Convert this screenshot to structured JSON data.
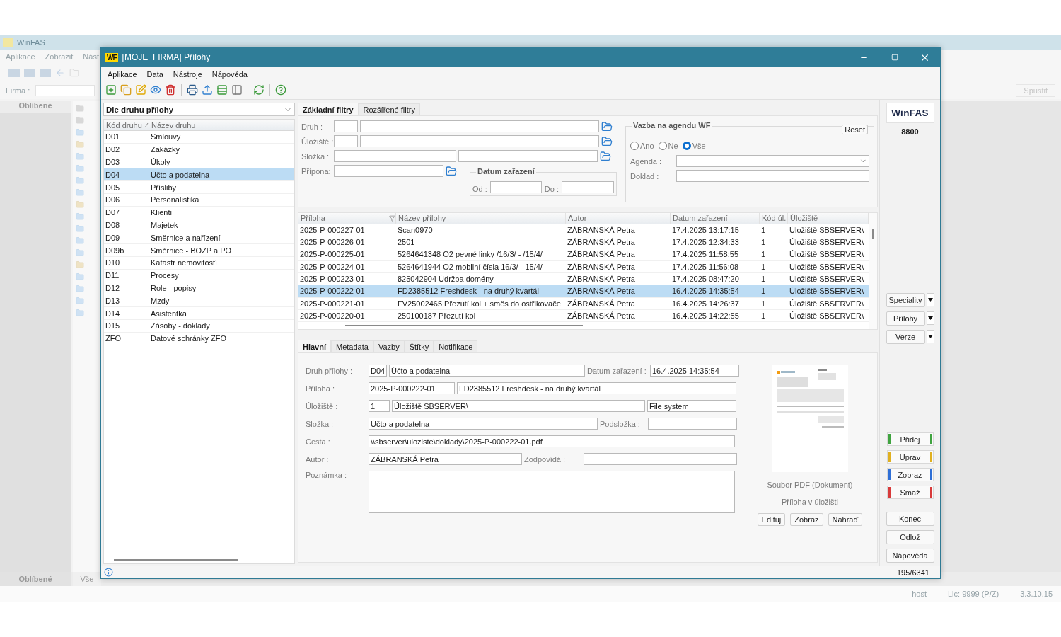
{
  "background_app": {
    "title": "WinFAS",
    "menu": [
      "Aplikace",
      "Zobrazit",
      "Nást"
    ],
    "company_label": "Firma :",
    "favorites_title": "Oblíbené",
    "run_button": "Spustit",
    "bottom_tabs": [
      {
        "label": "Oblíbené",
        "selected": true
      },
      {
        "label": "Vše",
        "selected": false
      }
    ],
    "status_bar": {
      "user": "host",
      "license": "Lic: 9999 (P/Z)",
      "version": "3.3.10.15"
    }
  },
  "window": {
    "logo": "WF",
    "title": "[MOJE_FIRMA] Přílohy"
  },
  "menu": [
    "Aplikace",
    "Data",
    "Nástroje",
    "Nápověda"
  ],
  "kinds_panel": {
    "view": "Dle druhu přílohy",
    "columns": [
      "Kód druhu",
      "Název druhu"
    ],
    "rows": [
      {
        "code": "D01",
        "name": "Smlouvy",
        "selected": false
      },
      {
        "code": "D02",
        "name": "Zakázky",
        "selected": false
      },
      {
        "code": "D03",
        "name": "Úkoly",
        "selected": false
      },
      {
        "code": "D04",
        "name": "Účto a podatelna",
        "selected": true
      },
      {
        "code": "D05",
        "name": "Přísliby",
        "selected": false
      },
      {
        "code": "D06",
        "name": "Personalistika",
        "selected": false
      },
      {
        "code": "D07",
        "name": "Klienti",
        "selected": false
      },
      {
        "code": "D08",
        "name": "Majetek",
        "selected": false
      },
      {
        "code": "D09",
        "name": "Směrnice a nařízení",
        "selected": false
      },
      {
        "code": "D09b",
        "name": "Směrnice - BOZP a PO",
        "selected": false
      },
      {
        "code": "D10",
        "name": "Katastr nemovitostí",
        "selected": false
      },
      {
        "code": "D11",
        "name": "Procesy",
        "selected": false
      },
      {
        "code": "D12",
        "name": "Role - popisy",
        "selected": false
      },
      {
        "code": "D13",
        "name": "Mzdy",
        "selected": false
      },
      {
        "code": "D14",
        "name": "Asistentka",
        "selected": false
      },
      {
        "code": "D15",
        "name": "Zásoby - doklady",
        "selected": false
      },
      {
        "code": "ZFO",
        "name": "Datové schránky ZFO",
        "selected": false
      }
    ]
  },
  "filter_tabs": [
    {
      "label": "Základní filtry",
      "selected": true
    },
    {
      "label": "Rozšířené filtry",
      "selected": false
    }
  ],
  "filters": {
    "type_label": "Druh :",
    "storage_label": "Úložiště :",
    "folder_label": "Složka :",
    "extension_label": "Přípona:",
    "date_group": {
      "title": "Datum zařazení",
      "from_label": "Od :",
      "to_label": "Do :"
    },
    "link_group": {
      "title": "Vazba na agendu WF",
      "reset": "Reset",
      "options": [
        {
          "label": "Ano",
          "selected": false
        },
        {
          "label": "Ne",
          "selected": false
        },
        {
          "label": "Vše",
          "selected": true
        }
      ],
      "agenda_label": "Agenda :",
      "document_label": "Doklad :"
    }
  },
  "table": {
    "columns": [
      "Příloha",
      "Název přílohy",
      "Autor",
      "Datum zařazení",
      "Kód úl.",
      "Úložiště"
    ],
    "rows": [
      {
        "cells": [
          "2025-P-000227-01",
          "Scan0970",
          "ZÁBRANSKÁ Petra",
          "17.4.2025 13:17:15",
          "1",
          "Úložiště SBSERVER\\"
        ],
        "selected": false
      },
      {
        "cells": [
          "2025-P-000226-01",
          "2501",
          "ZÁBRANSKÁ Petra",
          "17.4.2025 12:34:33",
          "1",
          "Úložiště SBSERVER\\"
        ],
        "selected": false
      },
      {
        "cells": [
          "2025-P-000225-01",
          "5264641348 O2 pevné linky /16/3/ - /15/4/",
          "ZÁBRANSKÁ Petra",
          "17.4.2025 11:58:55",
          "1",
          "Úložiště SBSERVER\\"
        ],
        "selected": false
      },
      {
        "cells": [
          "2025-P-000224-01",
          "5264641944 O2 mobilní čísla 16/3/ - 15/4/",
          "ZÁBRANSKÁ Petra",
          "17.4.2025 11:56:08",
          "1",
          "Úložiště SBSERVER\\"
        ],
        "selected": false
      },
      {
        "cells": [
          "2025-P-000223-01",
          "825042904 Údržba domény",
          "ZÁBRANSKÁ Petra",
          "17.4.2025 08:47:20",
          "1",
          "Úložiště SBSERVER\\"
        ],
        "selected": false
      },
      {
        "cells": [
          "2025-P-000222-01",
          "FD2385512 Freshdesk - na druhý kvartál",
          "ZÁBRANSKÁ Petra",
          "16.4.2025 14:35:54",
          "1",
          "Úložiště SBSERVER\\"
        ],
        "selected": true
      },
      {
        "cells": [
          "2025-P-000221-01",
          "FV25002465 Přezutí kol + směs do ostřikovače",
          "ZÁBRANSKÁ Petra",
          "16.4.2025 14:26:37",
          "1",
          "Úložiště SBSERVER\\"
        ],
        "selected": false
      },
      {
        "cells": [
          "2025-P-000220-01",
          "250100187 Přezutí kol",
          "ZÁBRANSKÁ Petra",
          "16.4.2025 14:22:55",
          "1",
          "Úložiště SBSERVER\\"
        ],
        "selected": false
      }
    ]
  },
  "detail_tabs": [
    {
      "label": "Hlavní",
      "selected": true
    },
    {
      "label": "Metadata",
      "selected": false
    },
    {
      "label": "Vazby",
      "selected": false
    },
    {
      "label": "Štítky",
      "selected": false
    },
    {
      "label": "Notifikace",
      "selected": false
    }
  ],
  "detail": {
    "kind_label": "Druh přílohy :",
    "kind_code": "D04",
    "kind_name": "Účto a podatelna",
    "date_label": "Datum zařazení :",
    "date": "16.4.2025 14:35:54",
    "attachment_label": "Příloha :",
    "attachment_id": "2025-P-000222-01",
    "attachment_name": "FD2385512 Freshdesk - na druhý kvartál",
    "storage_label": "Úložiště :",
    "storage_code": "1",
    "storage_name": "Úložiště SBSERVER\\",
    "storage_type": "File system",
    "folder_label": "Složka :",
    "folder": "Účto a podatelna",
    "subfolder_label": "Podsložka :",
    "path_label": "Cesta :",
    "path": "\\\\sbserver\\uloziste\\doklady\\2025-P-000222-01.pdf",
    "author_label": "Autor :",
    "author": "ZÁBRANSKÁ Petra",
    "responsible_label": "Zodpovídá :",
    "note_label": "Poznámka :"
  },
  "preview": {
    "kind": "picture",
    "file_type": "Soubor PDF (Dokument)",
    "location": "Příloha v úložišti",
    "buttons": [
      "Edituj",
      "Zobraz",
      "Nahraď"
    ]
  },
  "side": {
    "brand": "WinFAS",
    "number": "8800",
    "menus": [
      "Speciality",
      "Přílohy",
      "Verze"
    ],
    "actions": [
      {
        "label": "Přidej",
        "color": "#3fa33f"
      },
      {
        "label": "Uprav",
        "color": "#e0b020"
      },
      {
        "label": "Zobraz",
        "color": "#2f6fd6"
      },
      {
        "label": "Smaž",
        "color": "#d83a3a"
      }
    ],
    "buttons": [
      "Konec",
      "Odlož",
      "Nápověda"
    ]
  },
  "status_bar": {
    "count": "195/6341"
  }
}
